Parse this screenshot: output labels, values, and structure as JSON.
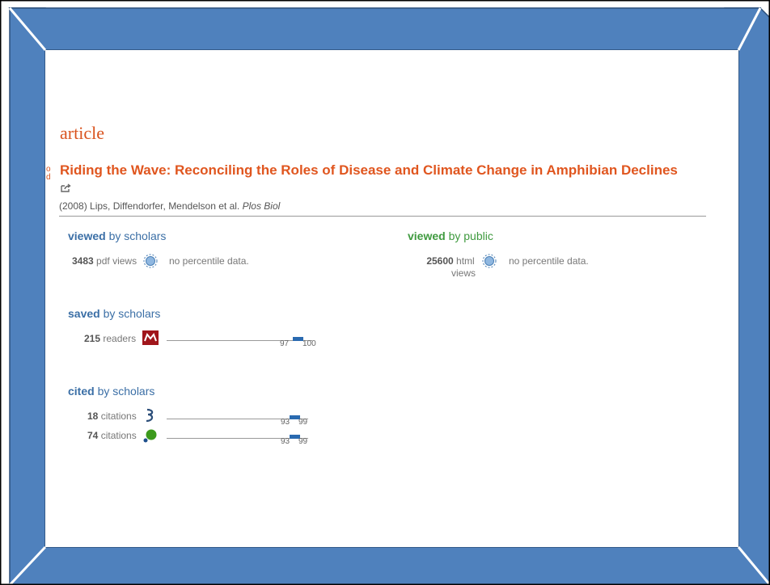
{
  "frame": {
    "color": "#4f81bd",
    "edge_color": "#2f5f8f"
  },
  "article": {
    "heading": "article",
    "side_mark": "o d",
    "title": "Riding the Wave: Reconciling the Roles of Disease and Climate Change in Amphibian Declines",
    "citation_prefix": "(2008) Lips, Diffendorfer, Mendelson et al.",
    "journal": "Plos Biol"
  },
  "sections": {
    "viewed_scholars": {
      "bold": "viewed",
      "rest": " by scholars",
      "count": "3483",
      "unit": "pdf views",
      "icon": "pubmed-globe-icon",
      "pctl": "no percentile data."
    },
    "viewed_public": {
      "bold": "viewed",
      "rest": " by public",
      "count": "25600",
      "unit_line1": "html",
      "unit_line2": "views",
      "icon": "pubmed-globe-icon",
      "pctl": "no percentile data."
    },
    "saved_scholars": {
      "bold": "saved",
      "rest": " by scholars",
      "rows": [
        {
          "count": "215",
          "unit": "readers",
          "icon": "mendeley-icon",
          "low": "97",
          "high": "100"
        }
      ]
    },
    "cited_scholars": {
      "bold": "cited",
      "rest": " by scholars",
      "rows": [
        {
          "count": "18",
          "unit": "citations",
          "icon": "pubmed-central-icon",
          "low": "93",
          "high": "99"
        },
        {
          "count": "74",
          "unit": "citations",
          "icon": "scopus-icon",
          "low": "93",
          "high": "99"
        }
      ]
    }
  },
  "colors": {
    "accent": "#e0561f",
    "link": "#3b6fa6",
    "public": "#3f9a3f",
    "bar": "#2a6ab0"
  }
}
